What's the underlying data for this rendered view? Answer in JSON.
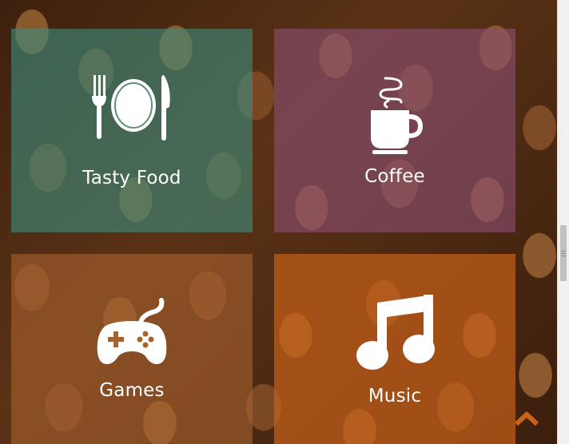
{
  "colors": {
    "food_tile": "#3e8a7a",
    "coffee_tile": "#8a4f73",
    "games_tile": "#a8622e",
    "music_tile": "#c8611a",
    "back_to_top": "#c8611a"
  },
  "tiles": [
    {
      "label": "Tasty Food",
      "icon": "fork-plate-knife-icon"
    },
    {
      "label": "Coffee",
      "icon": "coffee-cup-icon"
    },
    {
      "label": "Games",
      "icon": "gamepad-icon"
    },
    {
      "label": "Music",
      "icon": "music-note-icon"
    }
  ],
  "back_to_top": {
    "icon": "chevron-up-icon"
  }
}
